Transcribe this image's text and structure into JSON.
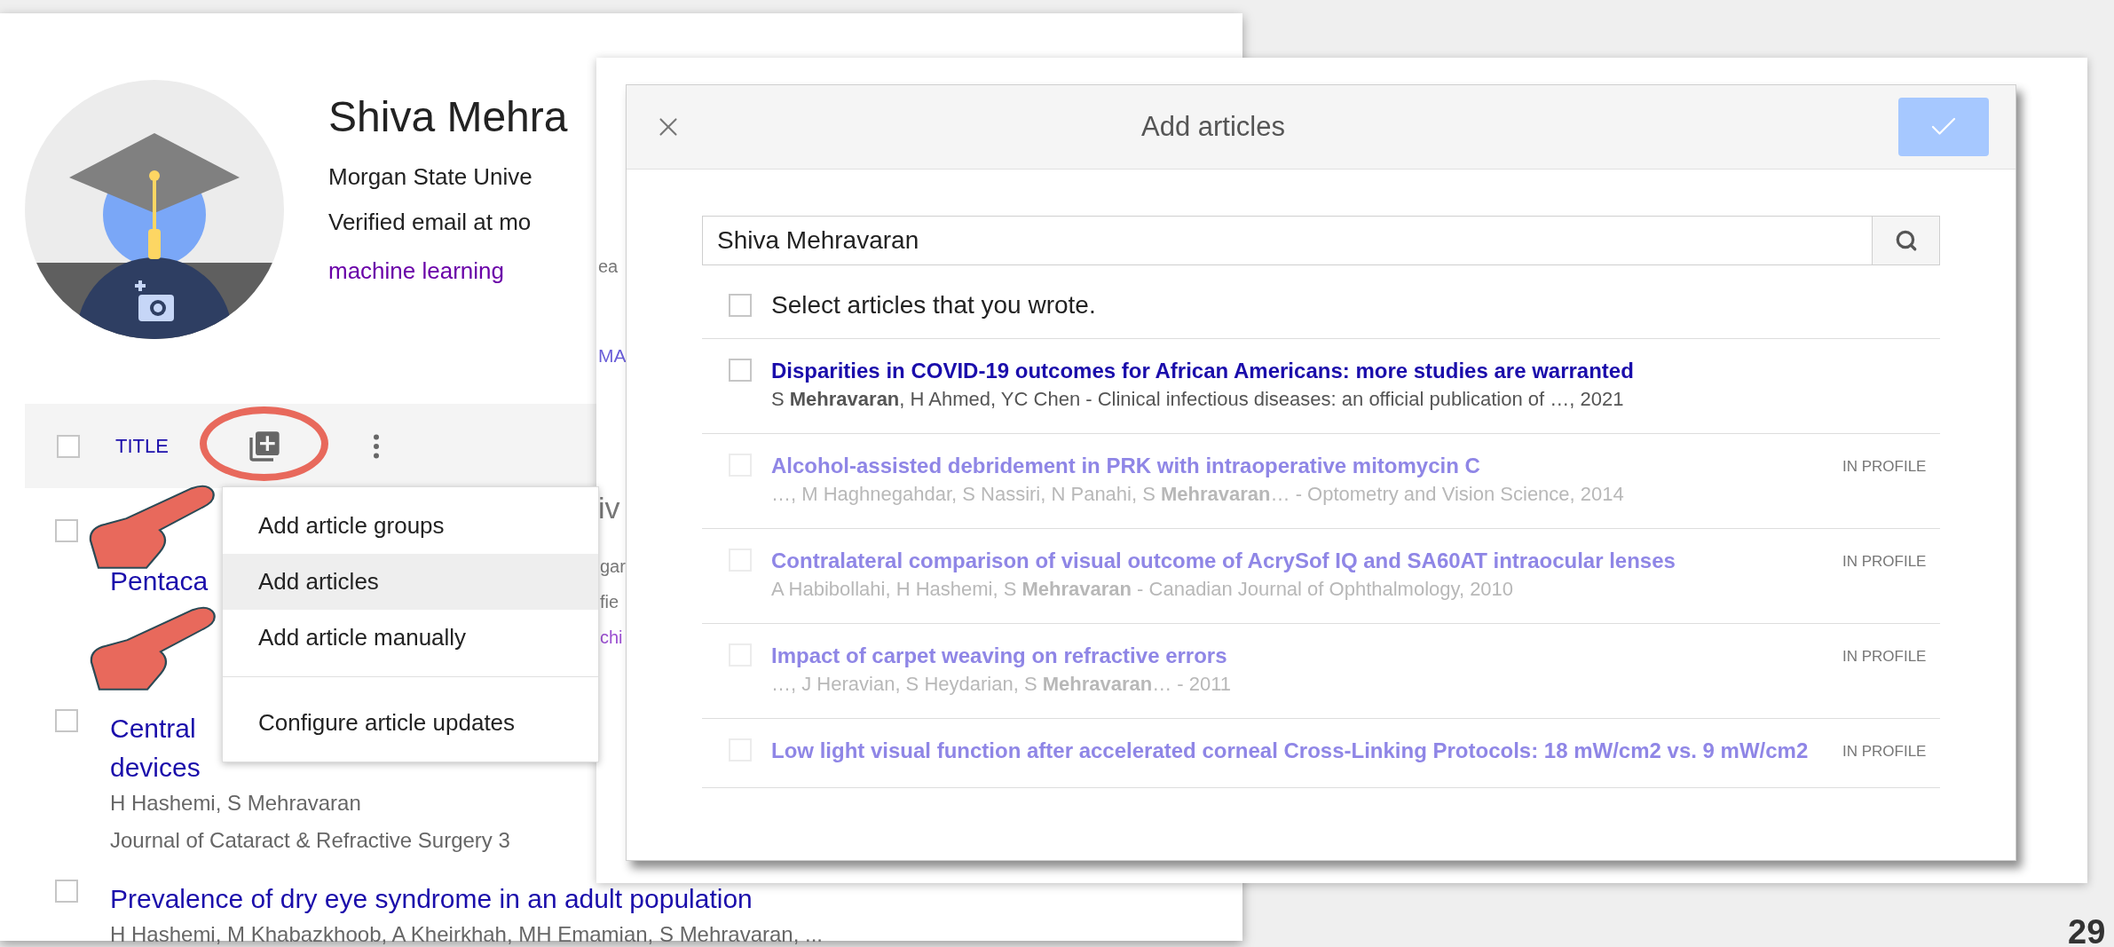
{
  "profile": {
    "name": "Shiva Mehra",
    "affiliation": "Morgan State Unive",
    "email": "Verified email at mo",
    "interest": "machine learning"
  },
  "toolbar": {
    "title_label": "TITLE",
    "select_all_checked": false
  },
  "articles": [
    {
      "title_lines": [
        "Pentaca"
      ],
      "checked": false
    },
    {
      "title_lines": [
        "Central",
        "devices"
      ],
      "authors": "H Hashemi, S Mehravaran",
      "venue": "Journal of Cataract & Refractive Surgery 3",
      "checked": false
    },
    {
      "title_lines": [
        "Prevalence of dry eye syndrome in an adult population"
      ],
      "authors": "H Hashemi, M Khabazkhoob, A Kheirkhah, MH Emamian, S Mehravaran, ...",
      "checked": false
    }
  ],
  "menu": {
    "groups": [
      [
        {
          "label": "Add article groups",
          "selected": false
        },
        {
          "label": "Add articles",
          "selected": true
        },
        {
          "label": "Add article manually",
          "selected": false
        }
      ],
      [
        {
          "label": "Configure article updates",
          "selected": false
        }
      ]
    ]
  },
  "background_window": {
    "fragments": [
      {
        "text": "ea",
        "kind": "muted"
      },
      {
        "text": "MA",
        "kind": "link"
      },
      {
        "text": "iv",
        "kind": "heading"
      },
      {
        "text": "gar",
        "kind": "muted"
      },
      {
        "text": "fie",
        "kind": "muted"
      },
      {
        "text": "chi",
        "kind": "tag"
      }
    ]
  },
  "modal": {
    "title": "Add articles",
    "confirm_disabled": true,
    "search": {
      "value": "Shiva Mehravaran"
    },
    "select_all": {
      "label": "Select articles that you wrote.",
      "checked": false
    },
    "results": [
      {
        "title": "Disparities in COVID-19 outcomes for African Americans: more studies are warranted",
        "authors": "S **Mehravaran**, H Ahmed, YC Chen - Clinical infectious diseases: an official publication of …, 2021",
        "in_profile": false,
        "checked": false
      },
      {
        "title": "Alcohol-assisted debridement in PRK with intraoperative mitomycin C",
        "authors": "…, M Haghnegahdar, S Nassiri, N Panahi, S **Mehravaran**… - Optometry and Vision Science, 2014",
        "in_profile": true,
        "badge": "IN PROFILE",
        "checked": false
      },
      {
        "title": "Contralateral comparison of visual outcome of AcrySof IQ and SA60AT intraocular lenses",
        "authors": "A Habibollahi, H Hashemi, S **Mehravaran** - Canadian Journal of Ophthalmology, 2010",
        "in_profile": true,
        "badge": "IN PROFILE",
        "checked": false
      },
      {
        "title": "Impact of carpet weaving on refractive errors",
        "authors": "…, J Heravian, S Heydarian, S **Mehravaran**… - 2011",
        "in_profile": true,
        "badge": "IN PROFILE",
        "checked": false
      },
      {
        "title": "Low light visual function after accelerated corneal Cross-Linking Protocols: 18 mW/cm2 vs. 9 mW/cm2",
        "in_profile": true,
        "badge": "IN PROFILE",
        "checked": false
      }
    ]
  },
  "slide_number": "29"
}
